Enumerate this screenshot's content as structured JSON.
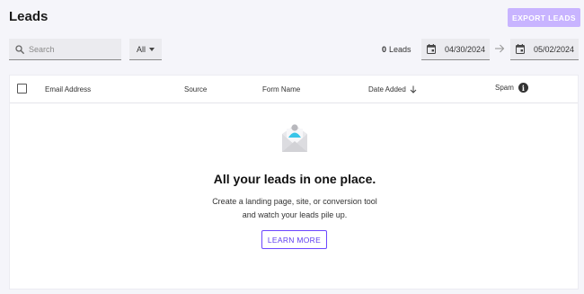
{
  "header": {
    "title": "Leads",
    "export_label": "EXPORT LEADS"
  },
  "filters": {
    "search_placeholder": "Search",
    "filter_value": "All",
    "lead_count": "0",
    "lead_count_label": "Leads",
    "start_date": "04/30/2024",
    "end_date": "05/02/2024"
  },
  "table": {
    "columns": [
      "Email Address",
      "Source",
      "Form Name",
      "Date Added",
      "Spam"
    ]
  },
  "empty_state": {
    "title": "All your leads in one place.",
    "description": "Create a landing page, site, or conversion tool and watch your leads pile up.",
    "button_label": "LEARN MORE"
  },
  "colors": {
    "accent": "#6c47ff",
    "export_disabled": "#c8b4ff",
    "avatar": "#39c5e8"
  },
  "icons": [
    "search-icon",
    "calendar-icon",
    "arrow-right-icon",
    "sort-arrow-down-icon",
    "info-icon",
    "envelope-person-icon"
  ]
}
